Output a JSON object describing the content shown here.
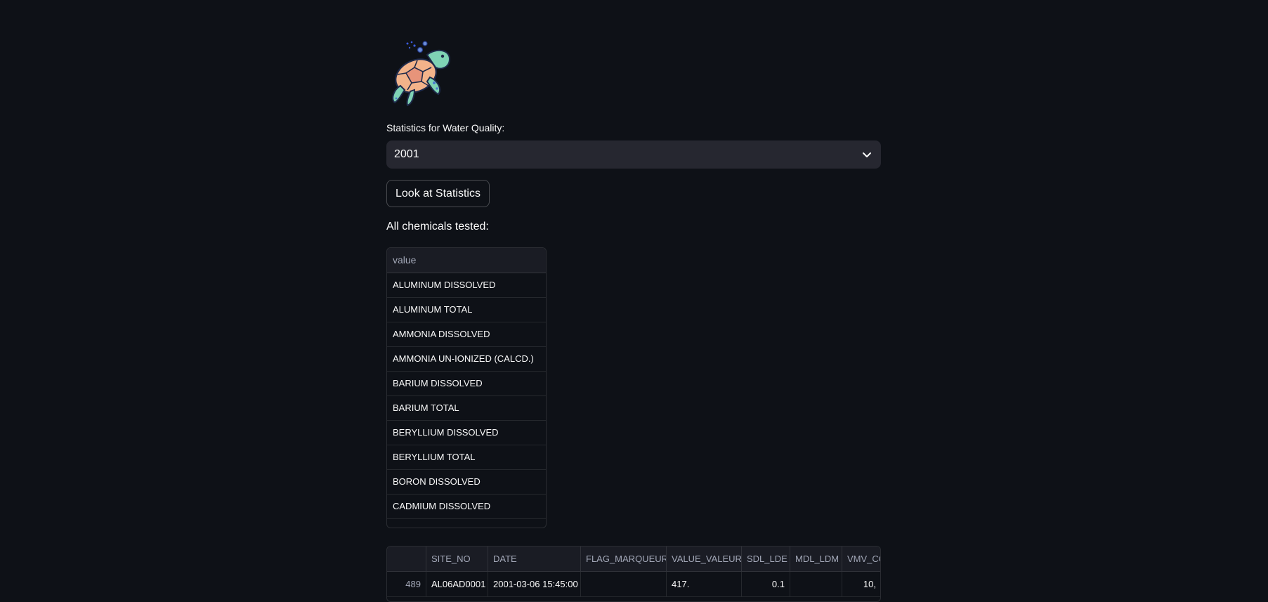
{
  "logo": {
    "icon": "sea-turtle-icon"
  },
  "selector": {
    "label": "Statistics for Water Quality:",
    "value": "2001"
  },
  "button": {
    "label": "Look at Statistics"
  },
  "chemicals": {
    "title": "All chemicals tested:",
    "header": "value",
    "items": [
      "ALUMINUM DISSOLVED",
      "ALUMINUM TOTAL",
      "AMMONIA DISSOLVED",
      "AMMONIA UN-IONIZED (CALCD.)",
      "BARIUM DISSOLVED",
      "BARIUM TOTAL",
      "BERYLLIUM DISSOLVED",
      "BERYLLIUM TOTAL",
      "BORON DISSOLVED",
      "CADMIUM DISSOLVED"
    ]
  },
  "data_table": {
    "columns": [
      "",
      "SITE_NO",
      "DATE",
      "FLAG_MARQUEUR",
      "VALUE_VALEUR",
      "SDL_LDE",
      "MDL_LDM",
      "VMV_CO"
    ],
    "rows": [
      [
        "489",
        "AL06AD0001",
        "2001-03-06 15:45:00",
        "",
        "417.",
        "0.1",
        "",
        "10,"
      ]
    ]
  }
}
